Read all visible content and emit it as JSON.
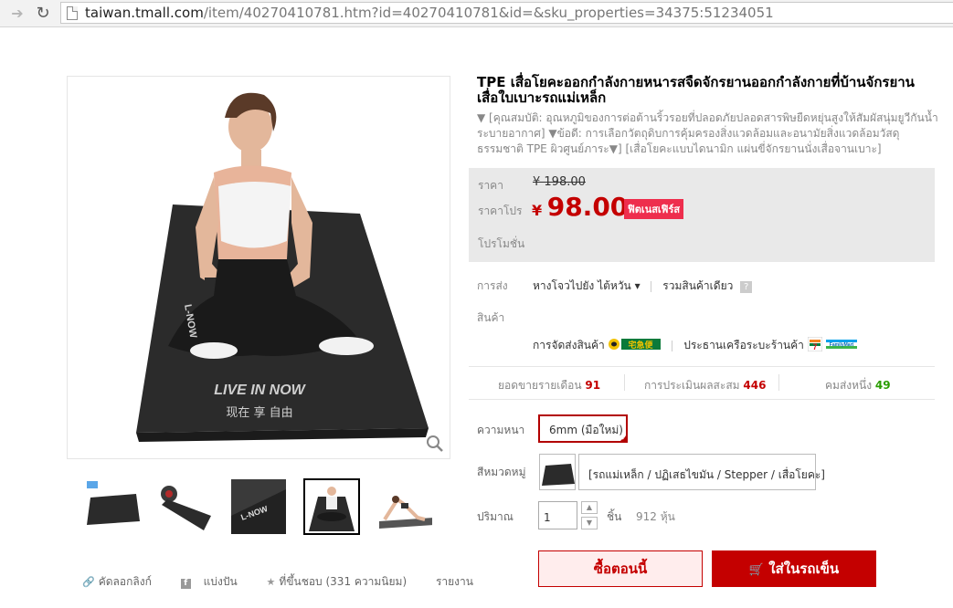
{
  "browser": {
    "url_domain": "taiwan.tmall.com",
    "url_path": "/item/40270410781.htm?id=40270410781&id=&sku_properties=34375:51234051"
  },
  "product": {
    "title": "TPE เสื่อโยคะออกกำลังกายหนารสจืดจักรยานออกกำลังกายที่บ้านจักรยานเสื่อใบเบาะรถแม่เหล็ก",
    "subtitle": "▼ [คุณสมบัติ: อุณหภูมิของการต่อต้านริ้วรอยที่ปลอดภัยปลอดสารพิษยืดหยุ่นสูงให้สัมผัสนุ่มยูวีกันน้ำระบายอากาศ] ▼ข้อดี: การเลือกวัตถุดิบการคุ้มครองสิ่งแวดล้อมและอนามัยสิ่งแวดล้อมวัสดุธรรมชาติ TPE ผิวศูนย์ภาระ▼] [เสื่อโยคะแบบไดนามิก แผ่นขี่จักรยานนั่งเสื่อจานเบาะ]"
  },
  "price": {
    "price_label": "ราคา",
    "original": "¥ 198.00",
    "promo_label": "ราคาโปร",
    "currency": "¥",
    "promo_value": "98.00",
    "promo_badge": "ฟิตเนสเฟิร์ส",
    "promotion_label": "โปรโมชั่น"
  },
  "shipping": {
    "label": "การส่ง",
    "from": "หางโจวไปยัง ไต้หวัน",
    "dropdown_arrow": "▾",
    "combine": "รวมสินค้าเดียว",
    "help": "?",
    "goods_label": "สินค้า",
    "delivery": "การจัดส่งสินค้า",
    "courier_logo_text": "宅急便",
    "store_pickup": "ประธานเครือระบะร้านค้า",
    "store_logo_text": "7",
    "familymart_text": "FamilyMart"
  },
  "stats": {
    "monthly_sales_label": "ยอดขายรายเดือน",
    "monthly_sales": "91",
    "reviews_label": "การประเมินผลสะสม",
    "reviews": "446",
    "points_label": "คมส่งหนึ่ง",
    "points": "49"
  },
  "options": {
    "thickness_label": "ความหนา",
    "thickness_value": "6mm (มือใหม่)",
    "color_label": "สีหมวดหมู่",
    "color_value": "[รถแม่เหล็ก / ปฏิเสธไขมัน / Stepper / เสื่อโยคะ]",
    "qty_label": "ปริมาณ",
    "qty_value": "1",
    "qty_unit": "ชิ้น",
    "stock": "912 หุ้น",
    "up_arrow": "▲",
    "down_arrow": "▼"
  },
  "actions": {
    "buy_now": "ซื้อตอนนี้",
    "add_to_cart": "ใส่ในรถเข็น",
    "cart_icon": "🛒"
  },
  "share": {
    "copy_link": "คัดลอกลิงก์",
    "share": "แบ่งปัน",
    "favorite": "ที่ขึ้นชอบ (331 ความนิยม)",
    "report": "รายงาน"
  },
  "image_text": {
    "mat_slogan": "LIVE IN NOW",
    "mat_cn": "现在 享 自由",
    "brand": "L-NOW"
  }
}
